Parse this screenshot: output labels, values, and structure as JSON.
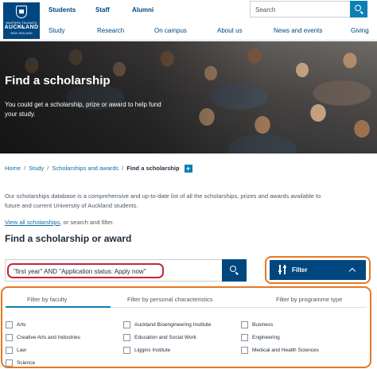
{
  "logo": {
    "line1": "WAIPAPA TAUMATA RAU",
    "line2": "AUCKLAND",
    "line3": "NEW ZEALAND"
  },
  "audience_nav": [
    "Students",
    "Staff",
    "Alumni"
  ],
  "site_search": {
    "placeholder": "Search"
  },
  "main_nav": [
    "Study",
    "Research",
    "On campus",
    "About us",
    "News and events",
    "Giving"
  ],
  "hero": {
    "title": "Find a scholarship",
    "text": "You could get a scholarship, prize or award to help fund your study."
  },
  "breadcrumb": {
    "items": [
      "Home",
      "Study",
      "Scholarships and awards"
    ],
    "current": "Find a scholarship",
    "plus": "+"
  },
  "intro": {
    "text": "Our scholarships database is a comprehensive and up-to-date list of all the scholarships, prizes and awards available to future and current University of Auckland students.",
    "link": "View all scholarships",
    "link_suffix": ", or search and filter."
  },
  "section_title": "Find a scholarship or award",
  "scholarship_search": {
    "value": "\"first year\" AND \"Application status: Apply now\""
  },
  "filter_button": {
    "label": "Filter"
  },
  "filter_tabs": [
    "Filter by faculty",
    "Filter by personal characteristics",
    "Filter by programme type"
  ],
  "filter_options": {
    "col1": [
      "Arts",
      "Creative Arts and Industries",
      "Law",
      "Science"
    ],
    "col2": [
      "Auckland Bioengineering Institute",
      "Education and Social Work",
      "Liggins Institute"
    ],
    "col3": [
      "Business",
      "Engineering",
      "Medical and Health Sciences"
    ]
  },
  "colors": {
    "brand_blue": "#00467f",
    "accent_blue": "#0d7fb4",
    "annotation_orange": "#e87722",
    "annotation_red": "#c4253a"
  }
}
